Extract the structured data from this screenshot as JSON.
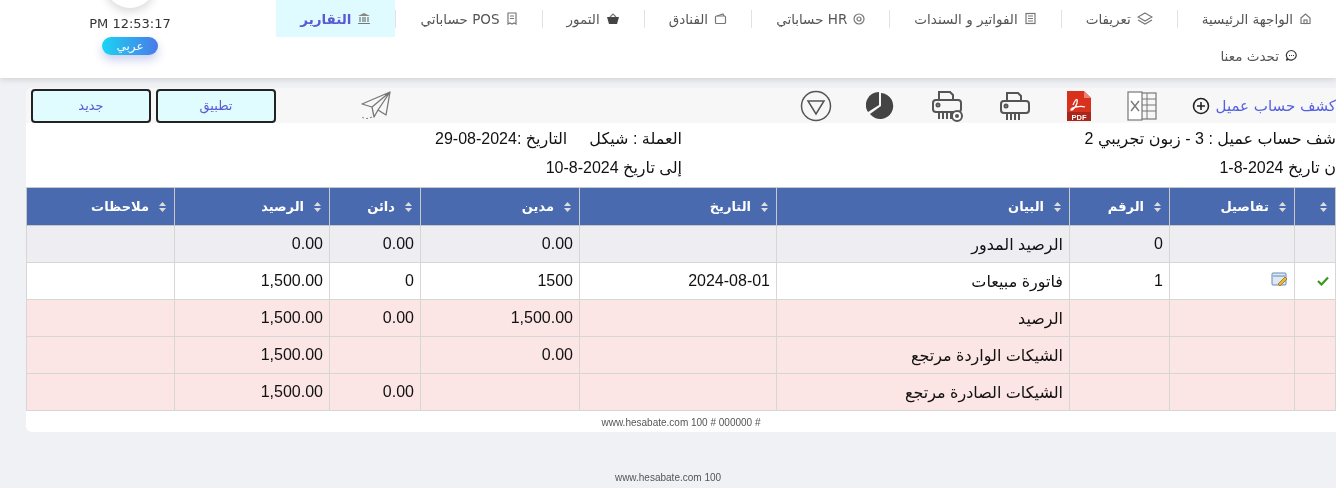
{
  "header": {
    "clock": "PM 12:53:17",
    "language_button": "عربي",
    "nav": [
      {
        "label": "الواجهة الرئيسية",
        "selected": false
      },
      {
        "label": "تعريفات",
        "selected": false
      },
      {
        "label": "الفواتير و السندات",
        "selected": false
      },
      {
        "label": "حساباتي HR",
        "selected": false
      },
      {
        "label": "الفنادق",
        "selected": false
      },
      {
        "label": "التمور",
        "selected": false
      },
      {
        "label": "حساباتي POS",
        "selected": false
      },
      {
        "label": "التقارير",
        "selected": true
      }
    ],
    "chat_link": "تحدث معنا"
  },
  "report": {
    "title": "كشف حساب عميل",
    "pdf_label": "PDF",
    "buttons": [
      "تطبيق",
      "جديد"
    ],
    "info": {
      "customer": "شف حساب عميل : 3 - زبون تجريبي 2",
      "currency": "العملة : شيكل",
      "date": "التاريخ :2024-08-29",
      "from_date": "ن تاريخ 2024-8-1",
      "to_date": "إلى تاريخ 2024-8-10"
    },
    "table": {
      "columns": [
        "",
        "تفاصيل",
        "الرقم",
        "البيان",
        "التاريخ",
        "مدين",
        "دائن",
        "الرصيد",
        "ملاحظات"
      ],
      "rows": [
        {
          "kind": "opening",
          "posted": false,
          "number": "0",
          "statement": "الرصيد المدور",
          "debit": "0.00",
          "credit": "0.00",
          "balance": "0.00"
        },
        {
          "kind": "entry",
          "posted": true,
          "number": "1",
          "statement": "فاتورة مبيعات",
          "date": "2024-08-01",
          "debit": "1500",
          "credit": "0",
          "balance": "1,500.00"
        },
        {
          "kind": "summary",
          "posted": false,
          "statement": "الرصيد",
          "debit": "1,500.00",
          "credit": "0.00",
          "balance": "1,500.00"
        },
        {
          "kind": "summary",
          "posted": false,
          "statement": "الشيكات الواردة مرتجع",
          "debit": "0.00",
          "balance": "1,500.00"
        },
        {
          "kind": "summary",
          "posted": false,
          "statement": "الشيكات الصادرة مرتجع",
          "credit": "0.00",
          "balance": "1,500.00"
        }
      ]
    },
    "footer": "www.hesabate.com 100 # 000000 #"
  },
  "page_footer": "www.hesabate.com 100"
}
